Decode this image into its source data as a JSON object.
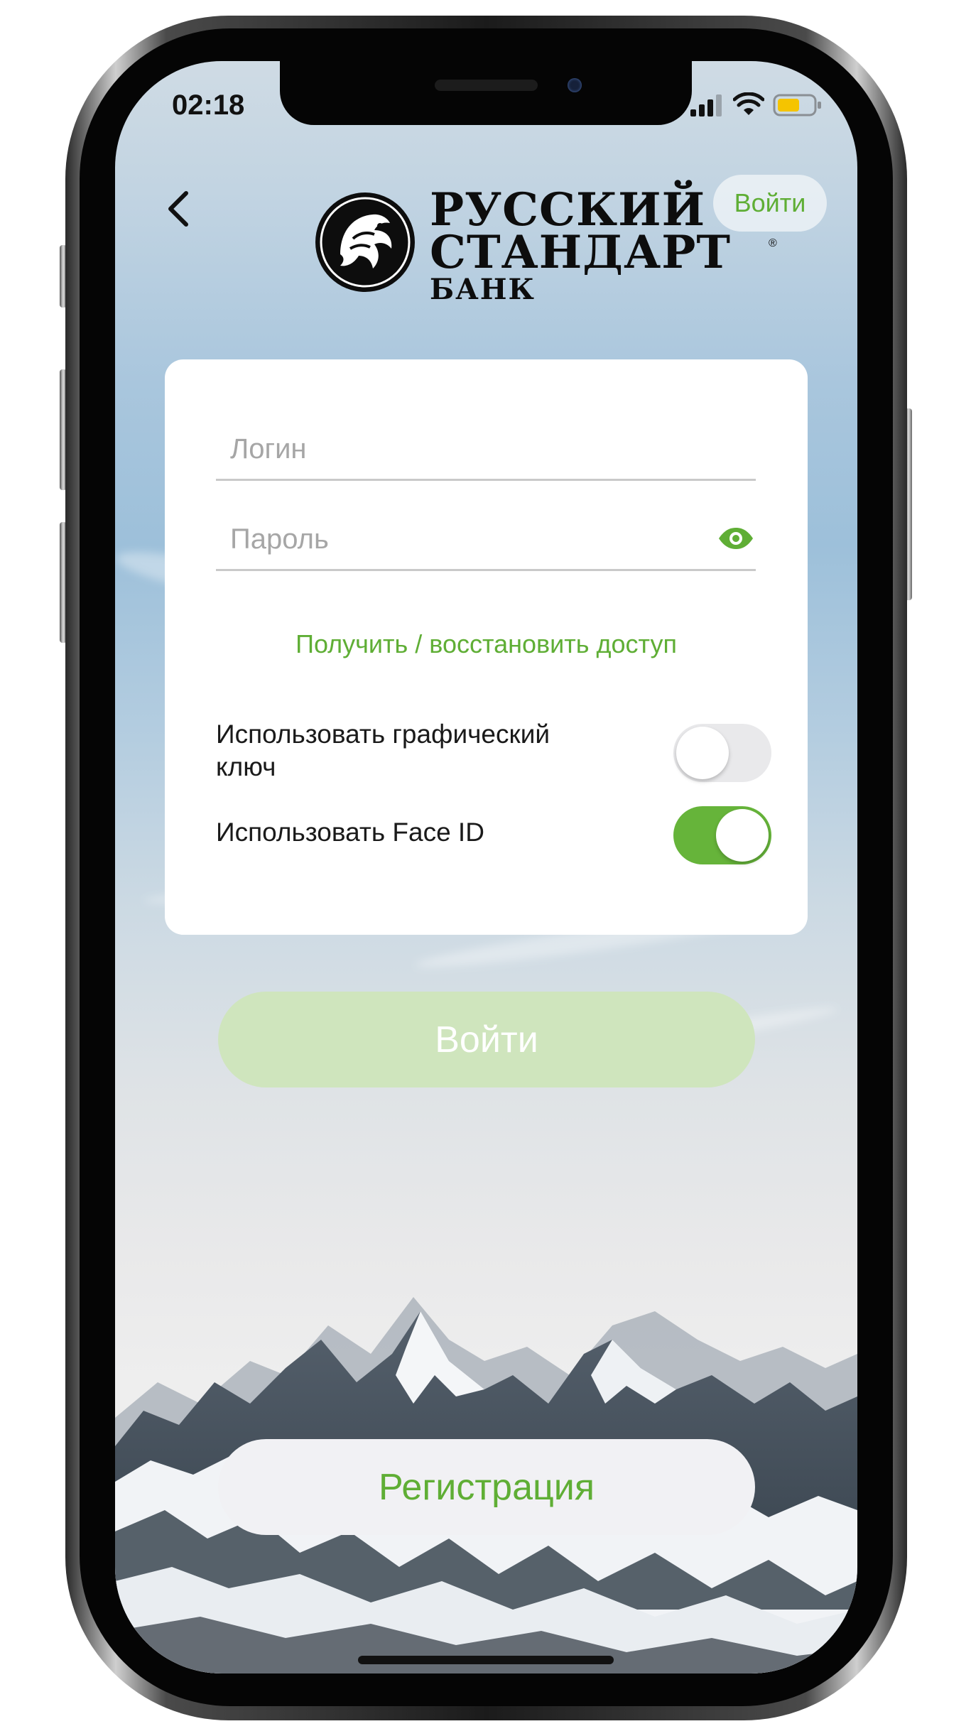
{
  "status_bar": {
    "time": "02:18",
    "icons": [
      "cellular-signal-icon",
      "wifi-icon",
      "battery-icon"
    ],
    "battery_color": "#f5c400"
  },
  "header": {
    "back_icon": "chevron-left-icon",
    "login_label": "Войти"
  },
  "logo": {
    "line1": "РУССКИЙ",
    "line2": "СТАНДАРТ",
    "line3": "БАНК",
    "registered_mark": "®"
  },
  "form": {
    "login_placeholder": "Логин",
    "login_value": "",
    "password_placeholder": "Пароль",
    "password_value": "",
    "show_password_icon": "eye-icon",
    "restore_link": "Получить / восстановить доступ",
    "pattern_key_label": "Использовать графический ключ",
    "pattern_key_enabled": false,
    "face_id_label": "Использовать Face ID",
    "face_id_enabled": true
  },
  "actions": {
    "submit_label": "Войти",
    "register_label": "Регистрация"
  },
  "colors": {
    "accent": "#5fae35",
    "toggle_on": "#66b43a",
    "submit_disabled": "#cfe5bd"
  }
}
